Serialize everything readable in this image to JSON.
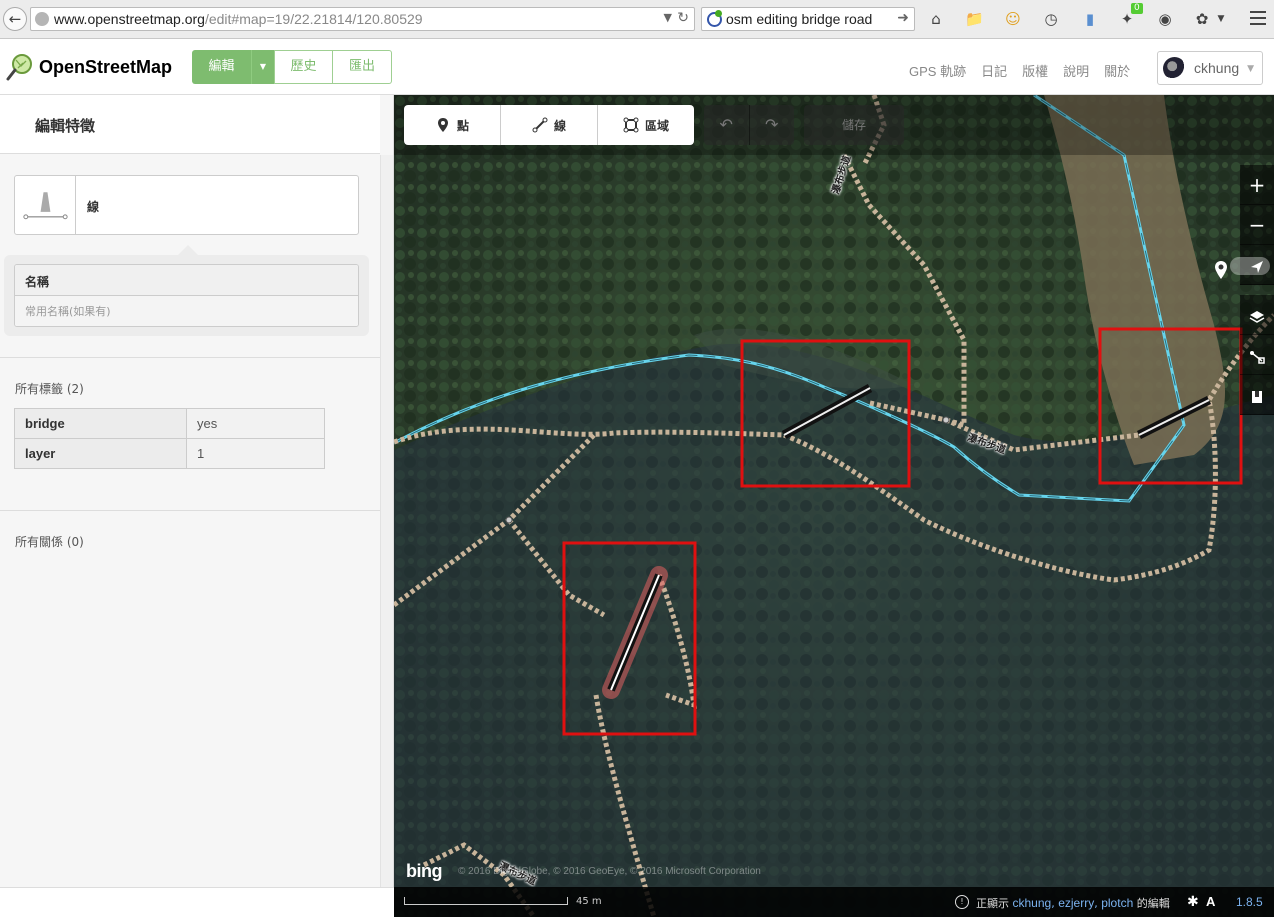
{
  "browser": {
    "url_domain": "www.openstreetmap.org",
    "url_path": "/edit#map=19/22.21814/120.80529",
    "search_text": "osm editing bridge road",
    "addon_badge": "0"
  },
  "header": {
    "site_title": "OpenStreetMap",
    "edit_label": "編輯",
    "history_label": "歷史",
    "export_label": "匯出",
    "nav_links": [
      "GPS 軌跡",
      "日記",
      "版權",
      "說明",
      "關於"
    ],
    "user_name": "ckhung"
  },
  "sidebar": {
    "title": "編輯特徵",
    "preset_name": "線",
    "name_label": "名稱",
    "name_placeholder": "常用名稱(如果有)",
    "all_tags_label": "所有標籤 (2)",
    "tags": [
      {
        "key": "bridge",
        "value": "yes"
      },
      {
        "key": "layer",
        "value": "1"
      }
    ],
    "relations_label": "所有關係 (0)"
  },
  "map": {
    "modes": {
      "point": "點",
      "line": "線",
      "area": "區域"
    },
    "save_label": "儲存",
    "zoom_in": "+",
    "zoom_out": "−",
    "road_label_1": "瀑布步道",
    "road_label_2": "瀑布步道",
    "road_label_3": "瀑布步道",
    "attribution": "© 2016 DigitalGlobe, © 2016 GeoEye, © 2016 Microsoft Corporation",
    "bing": "bing",
    "scale_label": "45 m",
    "editors_prefix": "正顯示",
    "editors": [
      "ckhung",
      "ezjerry",
      "plotch"
    ],
    "editors_suffix": "的編輯",
    "version": "1.8.5",
    "colors": {
      "highlight_box": "#e01010",
      "stream": "#66d4ec",
      "path": "#c8b49a",
      "bridge_casing": "#111111",
      "selected": "#e06060"
    }
  }
}
